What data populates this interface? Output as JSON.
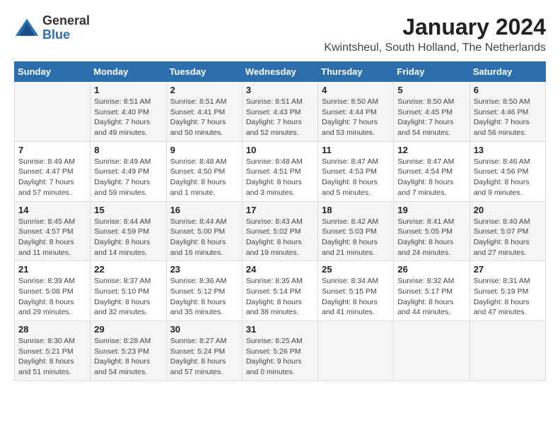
{
  "logo": {
    "general": "General",
    "blue": "Blue"
  },
  "title": "January 2024",
  "location": "Kwintsheul, South Holland, The Netherlands",
  "headers": [
    "Sunday",
    "Monday",
    "Tuesday",
    "Wednesday",
    "Thursday",
    "Friday",
    "Saturday"
  ],
  "weeks": [
    [
      {
        "day": "",
        "info": ""
      },
      {
        "day": "1",
        "info": "Sunrise: 8:51 AM\nSunset: 4:40 PM\nDaylight: 7 hours\nand 49 minutes."
      },
      {
        "day": "2",
        "info": "Sunrise: 8:51 AM\nSunset: 4:41 PM\nDaylight: 7 hours\nand 50 minutes."
      },
      {
        "day": "3",
        "info": "Sunrise: 8:51 AM\nSunset: 4:43 PM\nDaylight: 7 hours\nand 52 minutes."
      },
      {
        "day": "4",
        "info": "Sunrise: 8:50 AM\nSunset: 4:44 PM\nDaylight: 7 hours\nand 53 minutes."
      },
      {
        "day": "5",
        "info": "Sunrise: 8:50 AM\nSunset: 4:45 PM\nDaylight: 7 hours\nand 54 minutes."
      },
      {
        "day": "6",
        "info": "Sunrise: 8:50 AM\nSunset: 4:46 PM\nDaylight: 7 hours\nand 56 minutes."
      }
    ],
    [
      {
        "day": "7",
        "info": "Sunrise: 8:49 AM\nSunset: 4:47 PM\nDaylight: 7 hours\nand 57 minutes."
      },
      {
        "day": "8",
        "info": "Sunrise: 8:49 AM\nSunset: 4:49 PM\nDaylight: 7 hours\nand 59 minutes."
      },
      {
        "day": "9",
        "info": "Sunrise: 8:48 AM\nSunset: 4:50 PM\nDaylight: 8 hours\nand 1 minute."
      },
      {
        "day": "10",
        "info": "Sunrise: 8:48 AM\nSunset: 4:51 PM\nDaylight: 8 hours\nand 3 minutes."
      },
      {
        "day": "11",
        "info": "Sunrise: 8:47 AM\nSunset: 4:53 PM\nDaylight: 8 hours\nand 5 minutes."
      },
      {
        "day": "12",
        "info": "Sunrise: 8:47 AM\nSunset: 4:54 PM\nDaylight: 8 hours\nand 7 minutes."
      },
      {
        "day": "13",
        "info": "Sunrise: 8:46 AM\nSunset: 4:56 PM\nDaylight: 8 hours\nand 9 minutes."
      }
    ],
    [
      {
        "day": "14",
        "info": "Sunrise: 8:45 AM\nSunset: 4:57 PM\nDaylight: 8 hours\nand 11 minutes."
      },
      {
        "day": "15",
        "info": "Sunrise: 8:44 AM\nSunset: 4:59 PM\nDaylight: 8 hours\nand 14 minutes."
      },
      {
        "day": "16",
        "info": "Sunrise: 8:44 AM\nSunset: 5:00 PM\nDaylight: 8 hours\nand 16 minutes."
      },
      {
        "day": "17",
        "info": "Sunrise: 8:43 AM\nSunset: 5:02 PM\nDaylight: 8 hours\nand 19 minutes."
      },
      {
        "day": "18",
        "info": "Sunrise: 8:42 AM\nSunset: 5:03 PM\nDaylight: 8 hours\nand 21 minutes."
      },
      {
        "day": "19",
        "info": "Sunrise: 8:41 AM\nSunset: 5:05 PM\nDaylight: 8 hours\nand 24 minutes."
      },
      {
        "day": "20",
        "info": "Sunrise: 8:40 AM\nSunset: 5:07 PM\nDaylight: 8 hours\nand 27 minutes."
      }
    ],
    [
      {
        "day": "21",
        "info": "Sunrise: 8:39 AM\nSunset: 5:08 PM\nDaylight: 8 hours\nand 29 minutes."
      },
      {
        "day": "22",
        "info": "Sunrise: 8:37 AM\nSunset: 5:10 PM\nDaylight: 8 hours\nand 32 minutes."
      },
      {
        "day": "23",
        "info": "Sunrise: 8:36 AM\nSunset: 5:12 PM\nDaylight: 8 hours\nand 35 minutes."
      },
      {
        "day": "24",
        "info": "Sunrise: 8:35 AM\nSunset: 5:14 PM\nDaylight: 8 hours\nand 38 minutes."
      },
      {
        "day": "25",
        "info": "Sunrise: 8:34 AM\nSunset: 5:15 PM\nDaylight: 8 hours\nand 41 minutes."
      },
      {
        "day": "26",
        "info": "Sunrise: 8:32 AM\nSunset: 5:17 PM\nDaylight: 8 hours\nand 44 minutes."
      },
      {
        "day": "27",
        "info": "Sunrise: 8:31 AM\nSunset: 5:19 PM\nDaylight: 8 hours\nand 47 minutes."
      }
    ],
    [
      {
        "day": "28",
        "info": "Sunrise: 8:30 AM\nSunset: 5:21 PM\nDaylight: 8 hours\nand 51 minutes."
      },
      {
        "day": "29",
        "info": "Sunrise: 8:28 AM\nSunset: 5:23 PM\nDaylight: 8 hours\nand 54 minutes."
      },
      {
        "day": "30",
        "info": "Sunrise: 8:27 AM\nSunset: 5:24 PM\nDaylight: 8 hours\nand 57 minutes."
      },
      {
        "day": "31",
        "info": "Sunrise: 8:25 AM\nSunset: 5:26 PM\nDaylight: 9 hours\nand 0 minutes."
      },
      {
        "day": "",
        "info": ""
      },
      {
        "day": "",
        "info": ""
      },
      {
        "day": "",
        "info": ""
      }
    ]
  ]
}
